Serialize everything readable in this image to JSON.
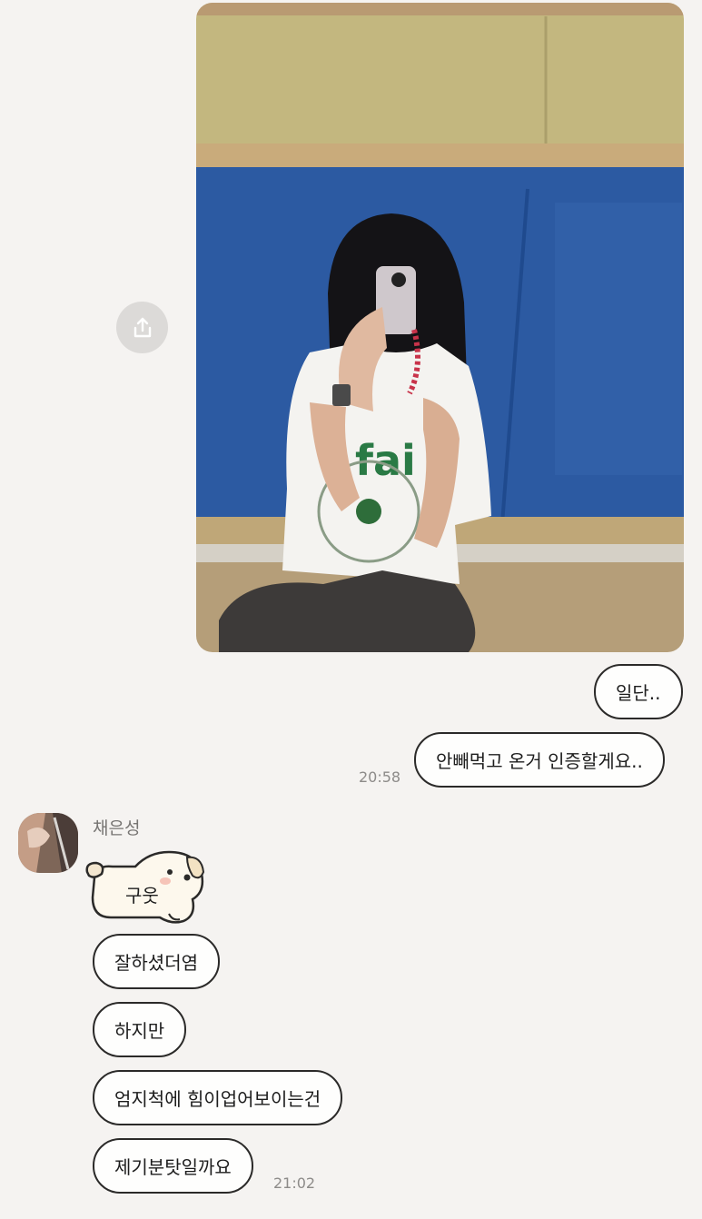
{
  "conversation": {
    "outgoing": {
      "messages": [
        "일단..",
        "안빼먹고 온거 인증할게요.."
      ],
      "time": "20:58"
    },
    "incoming": {
      "sender": "채은성",
      "sticker_text": "구웃",
      "messages": [
        "잘하셨더염",
        "하지만",
        "엄지척에 힘이업어보이는건",
        "제기분탓일까요"
      ],
      "time": "21:02"
    }
  },
  "icons": {
    "share": "share-icon",
    "sticker": "puppy-sticker",
    "avatar": "profile-avatar"
  },
  "colors": {
    "background": "#f5f3f1",
    "bubble_border": "#2b2a29",
    "bubble_fill": "#fefefd",
    "timestamp": "#8d8b89"
  }
}
